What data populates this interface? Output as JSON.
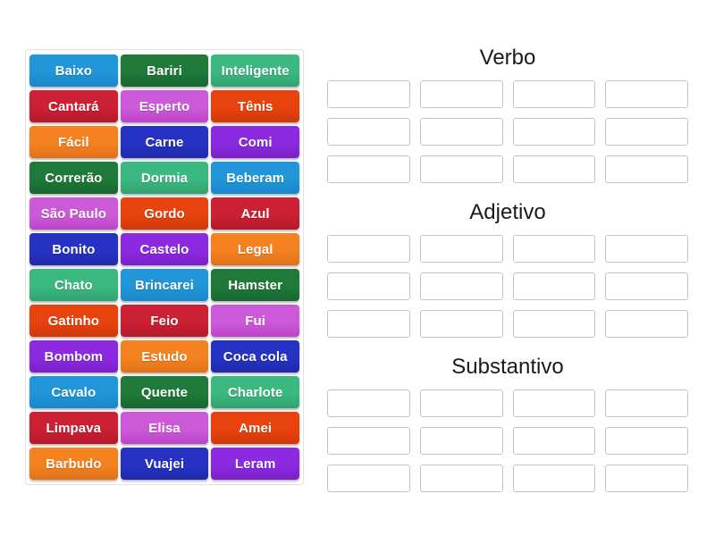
{
  "word_bank": {
    "name": "word-bank",
    "tiles": [
      {
        "label": "Baixo",
        "color": "#2196d8",
        "color_dark": "#1887c9"
      },
      {
        "label": "Bariri",
        "color": "#1f7a3a",
        "color_dark": "#176630"
      },
      {
        "label": "Inteligente",
        "color": "#3cb881",
        "color_dark": "#31a270"
      },
      {
        "label": "Cantará",
        "color": "#cc2034",
        "color_dark": "#b5182b"
      },
      {
        "label": "Esperto",
        "color": "#cc5ad8",
        "color_dark": "#bb45c9"
      },
      {
        "label": "Tênis",
        "color": "#e8430d",
        "color_dark": "#cf380a"
      },
      {
        "label": "Fácil",
        "color": "#f58220",
        "color_dark": "#e0711a"
      },
      {
        "label": "Carne",
        "color": "#2632c4",
        "color_dark": "#1f29ab"
      },
      {
        "label": "Comi",
        "color": "#8b2ae0",
        "color_dark": "#7a20c9"
      },
      {
        "label": "Correrão",
        "color": "#1f7a3a",
        "color_dark": "#176630"
      },
      {
        "label": "Dormia",
        "color": "#3cb881",
        "color_dark": "#31a270"
      },
      {
        "label": "Beberam",
        "color": "#2196d8",
        "color_dark": "#1887c9"
      },
      {
        "label": "São Paulo",
        "color": "#cc5ad8",
        "color_dark": "#bb45c9"
      },
      {
        "label": "Gordo",
        "color": "#e8430d",
        "color_dark": "#cf380a"
      },
      {
        "label": "Azul",
        "color": "#cc2034",
        "color_dark": "#b5182b"
      },
      {
        "label": "Bonito",
        "color": "#2632c4",
        "color_dark": "#1f29ab"
      },
      {
        "label": "Castelo",
        "color": "#8b2ae0",
        "color_dark": "#7a20c9"
      },
      {
        "label": "Legal",
        "color": "#f58220",
        "color_dark": "#e0711a"
      },
      {
        "label": "Chato",
        "color": "#3cb881",
        "color_dark": "#31a270"
      },
      {
        "label": "Brincarei",
        "color": "#2196d8",
        "color_dark": "#1887c9"
      },
      {
        "label": "Hamster",
        "color": "#1f7a3a",
        "color_dark": "#176630"
      },
      {
        "label": "Gatinho",
        "color": "#e8430d",
        "color_dark": "#cf380a"
      },
      {
        "label": "Feio",
        "color": "#cc2034",
        "color_dark": "#b5182b"
      },
      {
        "label": "Fui",
        "color": "#cc5ad8",
        "color_dark": "#bb45c9"
      },
      {
        "label": "Bombom",
        "color": "#8b2ae0",
        "color_dark": "#7a20c9"
      },
      {
        "label": "Estudo",
        "color": "#f58220",
        "color_dark": "#e0711a"
      },
      {
        "label": "Coca cola",
        "color": "#2632c4",
        "color_dark": "#1f29ab"
      },
      {
        "label": "Cavalo",
        "color": "#2196d8",
        "color_dark": "#1887c9"
      },
      {
        "label": "Quente",
        "color": "#1f7a3a",
        "color_dark": "#176630"
      },
      {
        "label": "Charlote",
        "color": "#3cb881",
        "color_dark": "#31a270"
      },
      {
        "label": "Limpava",
        "color": "#cc2034",
        "color_dark": "#b5182b"
      },
      {
        "label": "Elisa",
        "color": "#cc5ad8",
        "color_dark": "#bb45c9"
      },
      {
        "label": "Amei",
        "color": "#e8430d",
        "color_dark": "#cf380a"
      },
      {
        "label": "Barbudo",
        "color": "#f58220",
        "color_dark": "#e0711a"
      },
      {
        "label": "Vuajei",
        "color": "#2632c4",
        "color_dark": "#1f29ab"
      },
      {
        "label": "Leram",
        "color": "#8b2ae0",
        "color_dark": "#7a20c9"
      }
    ]
  },
  "groups": [
    {
      "title": "Verbo",
      "slot_count": 12,
      "slots": [
        "",
        "",
        "",
        "",
        "",
        "",
        "",
        "",
        "",
        "",
        "",
        ""
      ]
    },
    {
      "title": "Adjetivo",
      "slot_count": 12,
      "slots": [
        "",
        "",
        "",
        "",
        "",
        "",
        "",
        "",
        "",
        "",
        "",
        ""
      ]
    },
    {
      "title": "Substantivo",
      "slot_count": 12,
      "slots": [
        "",
        "",
        "",
        "",
        "",
        "",
        "",
        "",
        "",
        "",
        "",
        ""
      ]
    }
  ],
  "theme": {
    "page_background": "#ffffff",
    "panel_border": "#e2e2e2",
    "slot_border": "#c4c4c4",
    "title_color": "#1a1a1a",
    "tile_text_color": "#ffffff"
  }
}
